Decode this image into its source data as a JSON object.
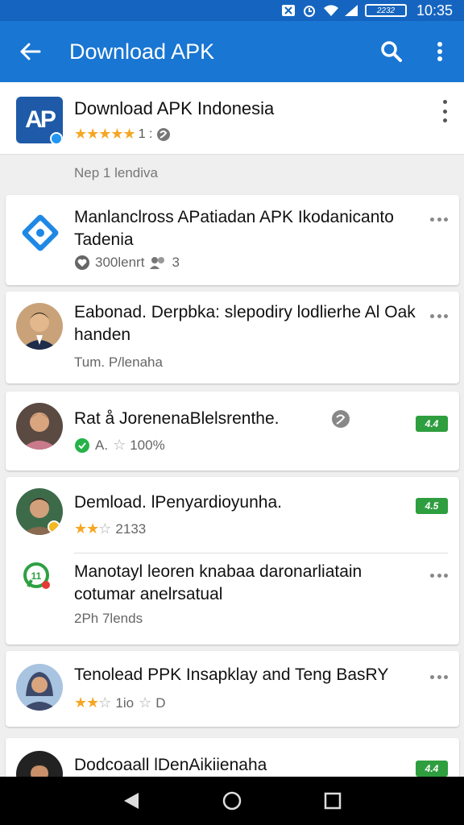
{
  "status_bar": {
    "time": "10:35",
    "battery": "2232"
  },
  "app_bar": {
    "title": "Download APK"
  },
  "header_app": {
    "logo_text": "AP",
    "name": "Download APK Indonesia",
    "stars": 5,
    "rating_text": "1 :"
  },
  "section_label": "Nep 1 lendiva",
  "items": [
    {
      "title": "Manlanclross APatiadan APK Ikodanicanto Tadenia",
      "meta": "300lenrt",
      "meta2": "3"
    },
    {
      "title": "Eabonad. Derpbka: slepodiry lodlierhe Al Oak handen",
      "meta": "Tum. P/lenaha"
    },
    {
      "title": "Rat å JorenenaBlelsrenthe.",
      "meta": "A.",
      "meta2": "100%",
      "badge": "4.4"
    },
    {
      "title": "Demload. lPenyardioyunha.",
      "meta": "2133",
      "badge": "4.5"
    },
    {
      "title": "Manotayl leoren knabaa daronarliatain cotumar anelrsatual",
      "meta": "2Ph 7lends"
    },
    {
      "title": "Tenolead PPK Insapklay and Teng BasRY",
      "meta": "1io",
      "meta2": "D"
    },
    {
      "title": "Dodcoaall lDenAikiienaha",
      "badge": "4.4"
    }
  ],
  "colors": {
    "primary": "#1976d2",
    "status": "#1565c0",
    "star": "#f5a623",
    "badge": "#2e9e3e"
  }
}
